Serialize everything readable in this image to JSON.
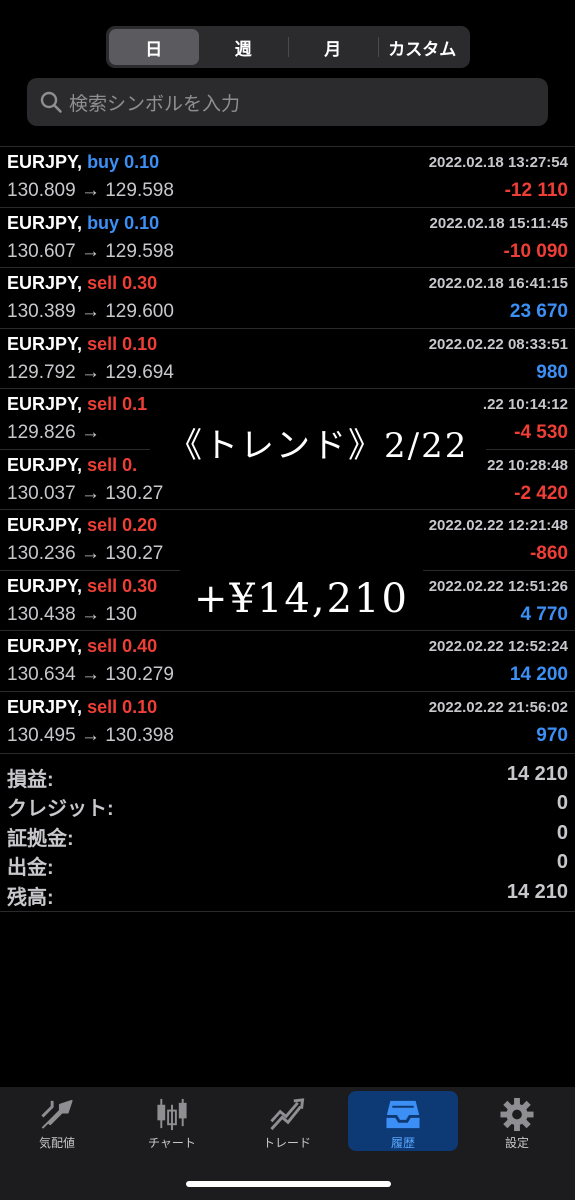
{
  "segment": {
    "options": [
      "日",
      "週",
      "月",
      "カスタム"
    ],
    "selected": "日"
  },
  "search": {
    "placeholder": "検索シンボルを入力"
  },
  "trades": [
    {
      "symbol": "EURJPY,",
      "side": "buy",
      "volume": "0.10",
      "time": "2022.02.18 13:27:54",
      "prices": "130.809 → 129.598",
      "profit": "-12 110"
    },
    {
      "symbol": "EURJPY,",
      "side": "buy",
      "volume": "0.10",
      "time": "2022.02.18 15:11:45",
      "prices": "130.607 → 129.598",
      "profit": "-10 090"
    },
    {
      "symbol": "EURJPY,",
      "side": "sell",
      "volume": "0.30",
      "time": "2022.02.18 16:41:15",
      "prices": "130.389 → 129.600",
      "profit": "23 670"
    },
    {
      "symbol": "EURJPY,",
      "side": "sell",
      "volume": "0.10",
      "time": "2022.02.22 08:33:51",
      "prices": "129.792 → 129.694",
      "profit": "980"
    },
    {
      "symbol": "EURJPY,",
      "side": "sell",
      "volume": "0.1",
      "time": ".22 10:14:12",
      "prices": "129.826 →",
      "profit": "-4 530"
    },
    {
      "symbol": "EURJPY,",
      "side": "sell",
      "volume": "0.",
      "time": ".22 10:28:48",
      "prices": "130.037 → 130.27",
      "profit": "-2 420"
    },
    {
      "symbol": "EURJPY,",
      "side": "sell",
      "volume": "0.20",
      "time": "2022.02.22 12:21:48",
      "prices": "130.236 → 130.27",
      "profit": "-860"
    },
    {
      "symbol": "EURJPY,",
      "side": "sell",
      "volume": "0.30",
      "time": "2022.02.22 12:51:26",
      "prices": "130.438 → 130",
      "profit": "4 770"
    },
    {
      "symbol": "EURJPY,",
      "side": "sell",
      "volume": "0.40",
      "time": "2022.02.22 12:52:24",
      "prices": "130.634 → 130.279",
      "profit": "14 200"
    },
    {
      "symbol": "EURJPY,",
      "side": "sell",
      "volume": "0.10",
      "time": "2022.02.22 21:56:02",
      "prices": "130.495 → 130.398",
      "profit": "970"
    }
  ],
  "summary": [
    {
      "label": "損益:",
      "value": "14 210"
    },
    {
      "label": "クレジット:",
      "value": "0"
    },
    {
      "label": "証拠金:",
      "value": "0"
    },
    {
      "label": "出金:",
      "value": "0"
    },
    {
      "label": "残高:",
      "value": "14 210"
    }
  ],
  "overlay": {
    "title": "《トレンド》2/22",
    "amount": "+¥14,210"
  },
  "tabs": [
    {
      "label": "気配値",
      "icon": "quotes-icon"
    },
    {
      "label": "チャート",
      "icon": "chart-icon"
    },
    {
      "label": "トレード",
      "icon": "trade-icon"
    },
    {
      "label": "履歴",
      "icon": "history-icon"
    },
    {
      "label": "設定",
      "icon": "settings-icon"
    }
  ],
  "colors": {
    "buy": "#3b8ff5",
    "sell": "#ef3e36",
    "active_tab_bg": "#0d3a75"
  }
}
